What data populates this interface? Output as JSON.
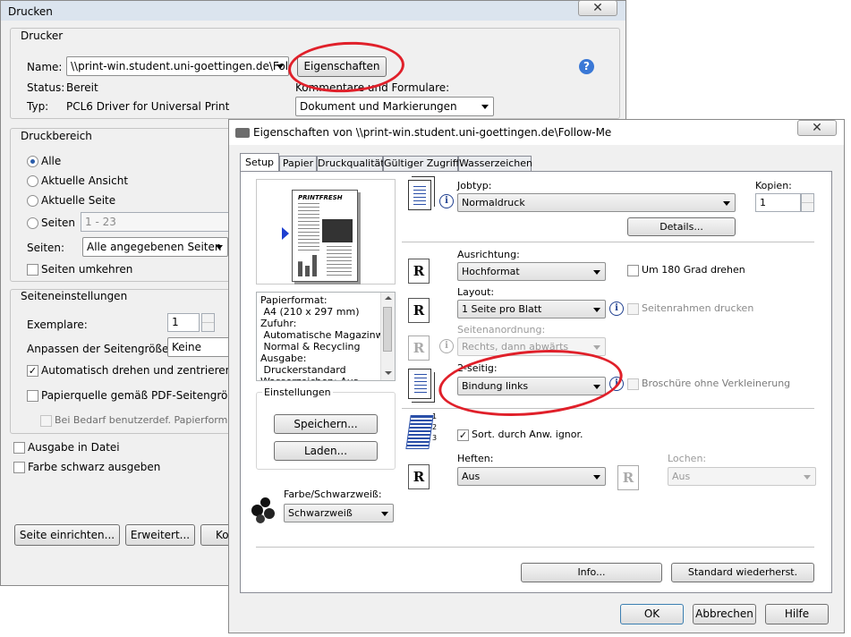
{
  "print_dialog": {
    "title": "Drucken",
    "printer_section": {
      "title": "Drucker",
      "name_label": "Name:",
      "name_value": "\\\\print-win.student.uni-goettingen.de\\Foll",
      "properties_button": "Eigenschaften",
      "status_label": "Status:",
      "status_value": "Bereit",
      "type_label": "Typ:",
      "type_value": "PCL6 Driver for Universal Print",
      "comments_label": "Kommentare und Formulare:",
      "comments_value": "Dokument und Markierungen"
    },
    "range_section": {
      "title": "Druckbereich",
      "radio_all": "Alle",
      "radio_current_view": "Aktuelle Ansicht",
      "radio_current_page": "Aktuelle Seite",
      "radio_pages": "Seiten",
      "pages_value": "1 - 23",
      "subset_label": "Seiten:",
      "subset_value": "Alle angegebenen Seiten",
      "reverse_pages": "Seiten umkehren"
    },
    "page_section": {
      "title": "Seiteneinstellungen",
      "copies_label": "Exemplare:",
      "copies_value": "1",
      "scaling_label": "Anpassen der Seitengröße:",
      "scaling_value": "Keine",
      "auto_rotate": "Automatisch drehen und zentrieren",
      "paper_source": "Papierquelle gemäß PDF-Seitengröße au",
      "custom_paper": "Bei Bedarf benutzerdef. Papierformat"
    },
    "print_to_file": "Ausgabe in Datei",
    "grayscale": "Farbe schwarz ausgeben",
    "buttons": {
      "page_setup": "Seite einrichten...",
      "advanced": "Erweitert...",
      "ko": "Ko"
    }
  },
  "properties_dialog": {
    "title": "Eigenschaften von \\\\print-win.student.uni-goettingen.de\\Follow-Me",
    "tabs": [
      "Setup",
      "Papier",
      "Druckqualität",
      "Gültiger Zugriff",
      "Wasserzeichen"
    ],
    "preview_headline": "PRINTFRESH",
    "summary_lines": [
      "Papierformat:",
      " A4 (210 x 297 mm)",
      "Zufuhr:",
      " Automatische Magazinwahl",
      " Normal & Recycling",
      "Ausgabe:",
      " Druckerstandard",
      "Wasserzeichen: Aus"
    ],
    "settings_group": {
      "title": "Einstellungen",
      "save_button": "Speichern...",
      "load_button": "Laden..."
    },
    "color_label": "Farbe/Schwarzweiß:",
    "color_value": "Schwarzweiß",
    "jobtype_label": "Jobtyp:",
    "jobtype_value": "Normaldruck",
    "copies_label": "Kopien:",
    "copies_value": "1",
    "details_button": "Details...",
    "orientation_label": "Ausrichtung:",
    "orientation_value": "Hochformat",
    "rotate_180": "Um 180 Grad drehen",
    "layout_label": "Layout:",
    "layout_value": "1 Seite pro Blatt",
    "page_frames": "Seitenrahmen drucken",
    "page_order_label": "Seitenanordnung:",
    "page_order_value": "Rechts, dann abwärts",
    "duplex_label": "2-seitig:",
    "duplex_value": "Bindung links",
    "booklet": "Broschüre ohne Verkleinerung",
    "sort_label": "Sort. durch Anw. ignor.",
    "stapling_label": "Heften:",
    "stapling_value": "Aus",
    "punching_label": "Lochen:",
    "punching_value": "Aus",
    "info_button": "Info...",
    "restore_button": "Standard wiederherst.",
    "ok_button": "OK",
    "cancel_button": "Abbrechen",
    "help_button": "Hilfe",
    "sort_numbers": "1 2 3"
  },
  "colors": {
    "highlight_ellipse": "#e0202a",
    "help_icon": "#3a78d6"
  }
}
